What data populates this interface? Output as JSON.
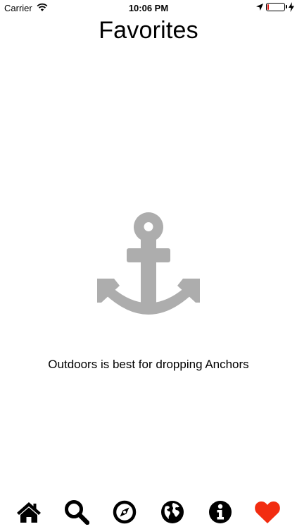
{
  "status_bar": {
    "carrier": "Carrier",
    "time": "10:06 PM",
    "battery_level_percent": 10,
    "battery_color": "#e0201b"
  },
  "header": {
    "title": "Favorites"
  },
  "empty_state": {
    "icon": "anchor-icon",
    "icon_color": "#adadad",
    "message": "Outdoors is best for dropping Anchors"
  },
  "tab_bar": {
    "tabs": [
      {
        "icon": "home-icon",
        "color": "#000000",
        "selected": false
      },
      {
        "icon": "search-icon",
        "color": "#000000",
        "selected": false
      },
      {
        "icon": "compass-icon",
        "color": "#000000",
        "selected": false
      },
      {
        "icon": "globe-icon",
        "color": "#000000",
        "selected": false
      },
      {
        "icon": "info-icon",
        "color": "#000000",
        "selected": false
      },
      {
        "icon": "heart-icon",
        "color": "#f22c10",
        "selected": true
      }
    ]
  }
}
